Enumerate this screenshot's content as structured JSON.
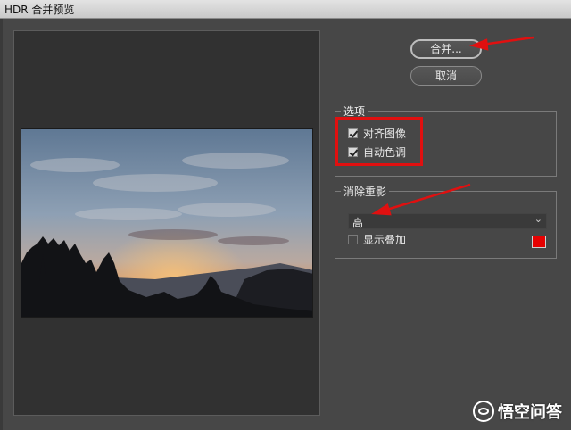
{
  "window": {
    "title": "HDR 合并预览"
  },
  "buttons": {
    "merge": "合并...",
    "cancel": "取消"
  },
  "options": {
    "group_title": "选项",
    "align_images": {
      "label": "对齐图像",
      "checked": true
    },
    "auto_tone": {
      "label": "自动色调",
      "checked": true
    }
  },
  "deghost": {
    "group_title": "消除重影",
    "level": "高",
    "show_overlay": {
      "label": "显示叠加",
      "checked": false
    },
    "overlay_color": "#e60000"
  },
  "preview": {
    "image_icon": "sunset-landscape-image"
  },
  "watermark": {
    "text": "悟空问答"
  },
  "colors": {
    "annotation": "#e01010",
    "dialog_bg": "#474747",
    "panel_bg": "#313131"
  }
}
